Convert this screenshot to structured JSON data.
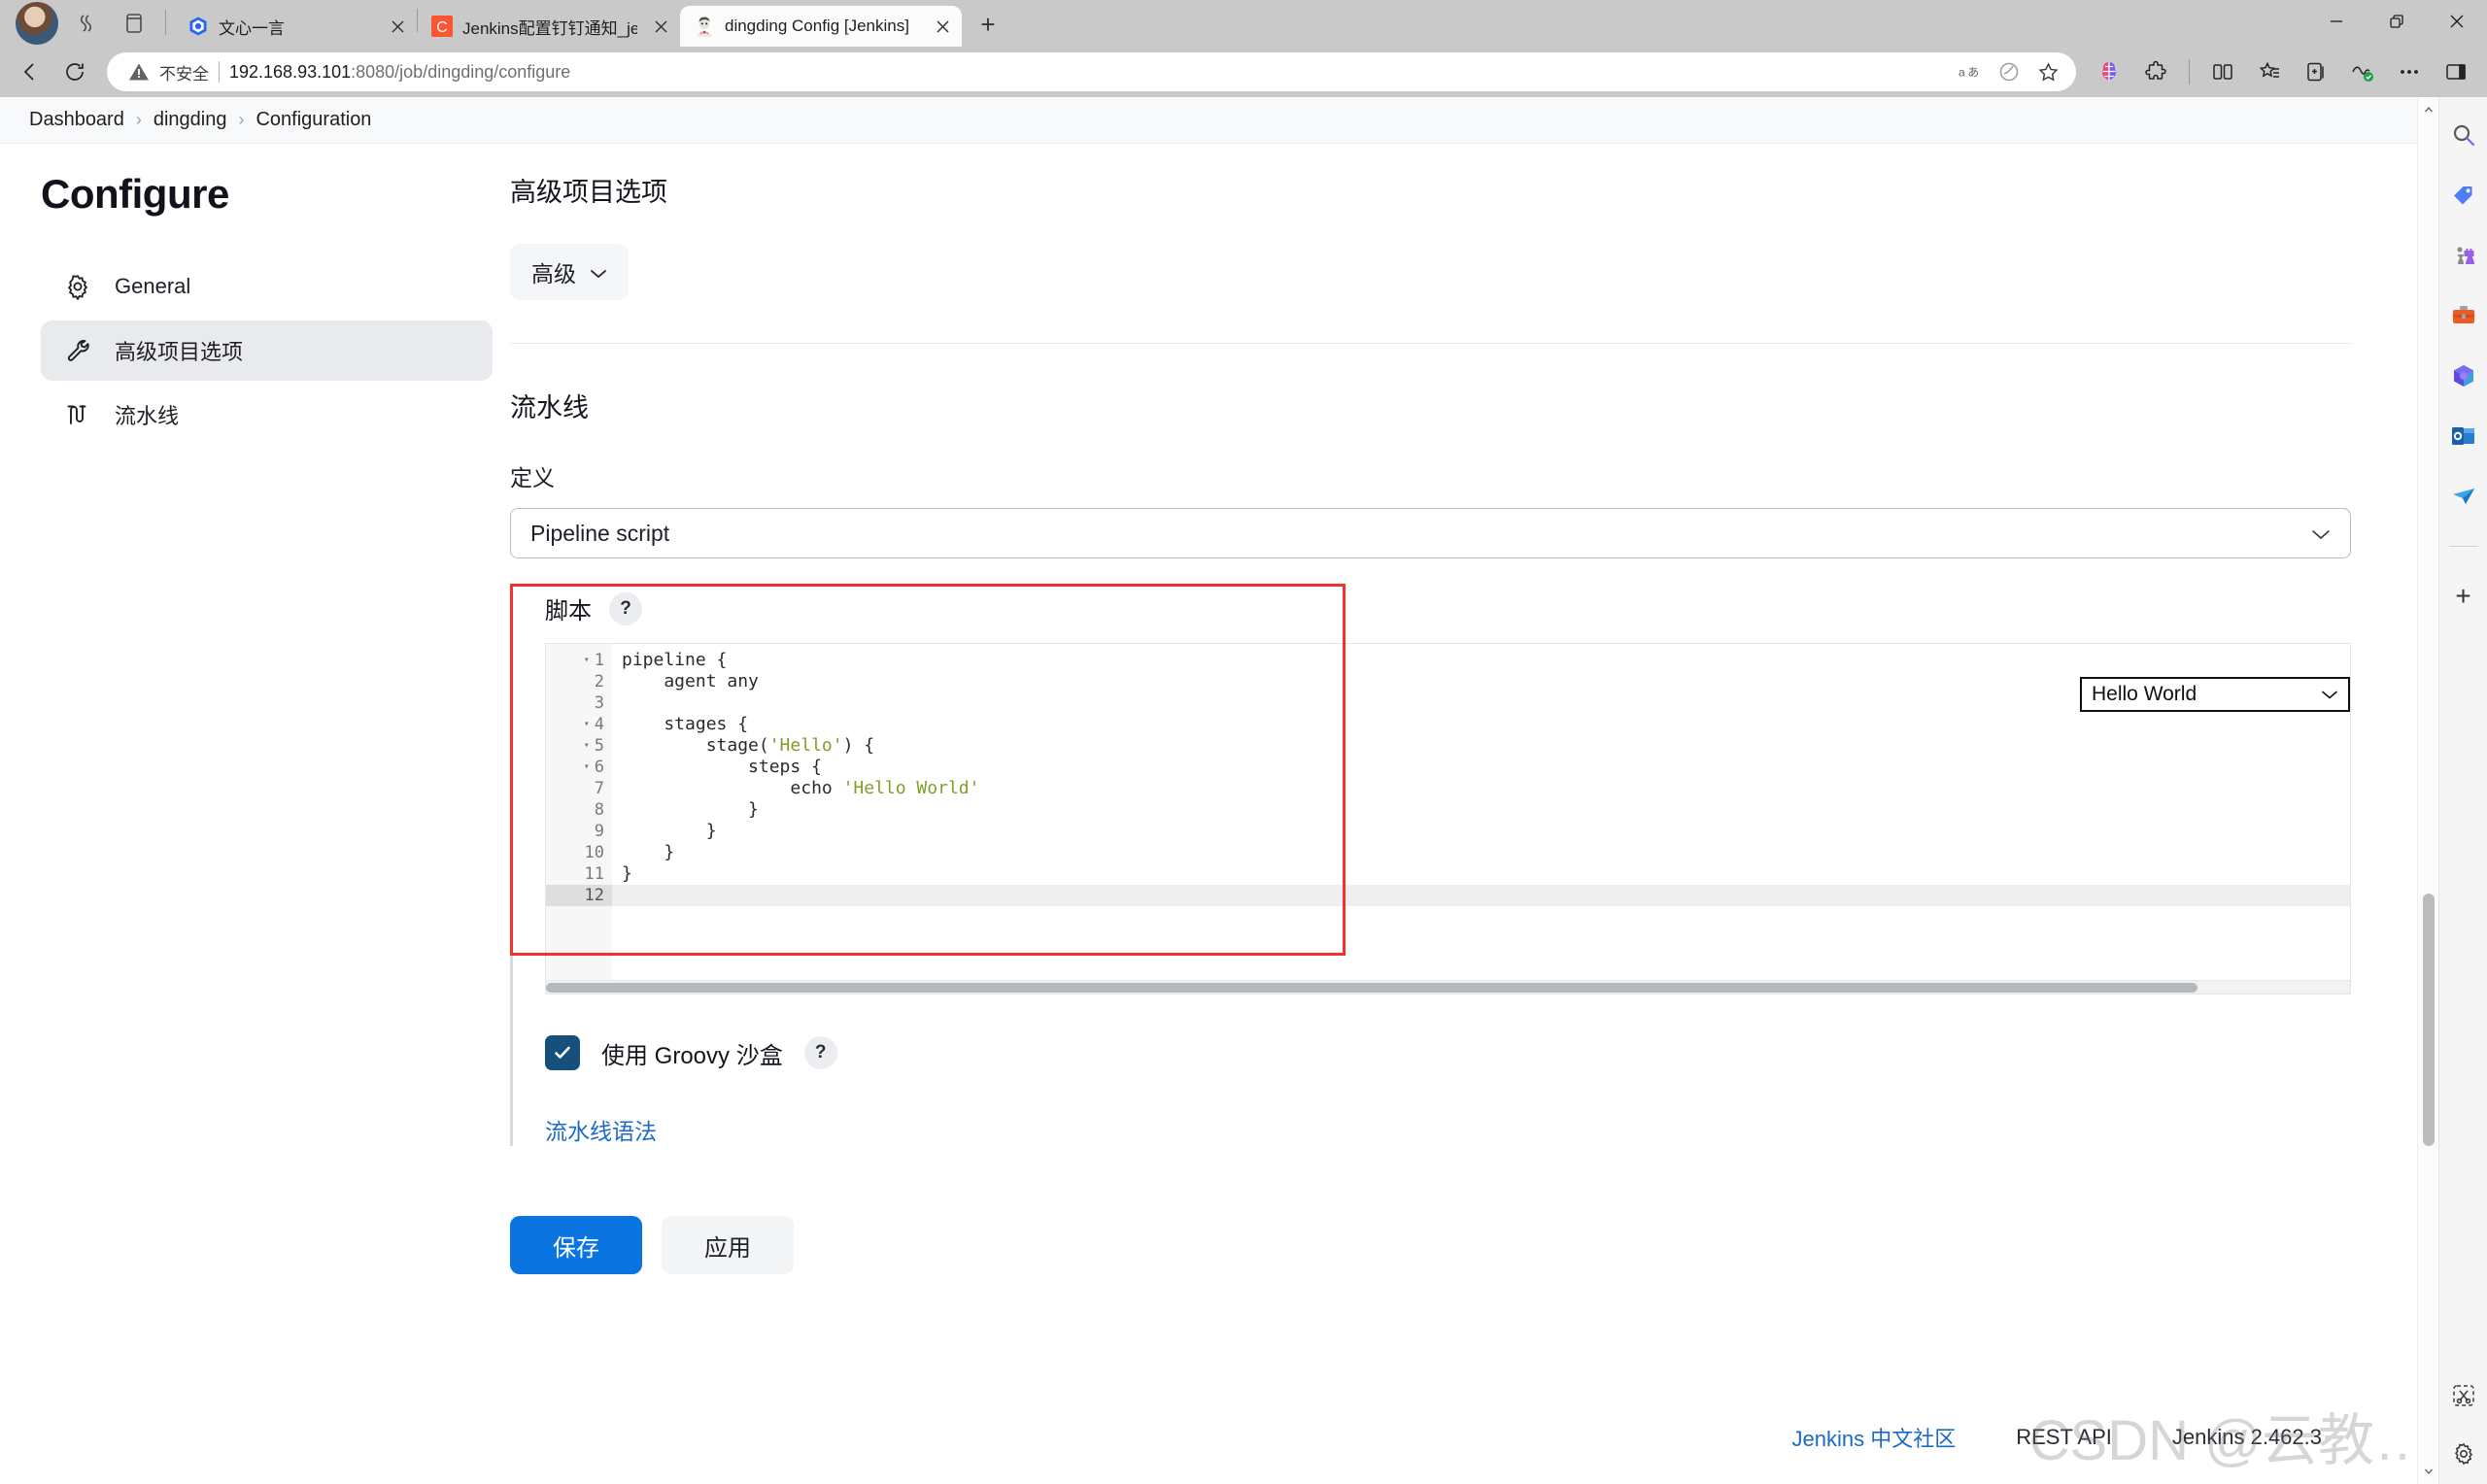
{
  "browser": {
    "window_controls": {
      "minimize": "minimize-icon",
      "maximize": "restore-icon",
      "close": "close-icon"
    },
    "tabs": [
      {
        "title": "文心一言",
        "favicon": "ernie-icon",
        "active": false
      },
      {
        "title": "Jenkins配置钉钉通知_jenkins钉钉",
        "favicon": "csdn-icon",
        "active": false
      },
      {
        "title": "dingding Config [Jenkins]",
        "favicon": "jenkins-butler-icon",
        "active": true
      }
    ],
    "new_tab_label": "+",
    "address": {
      "security_label": "不安全",
      "url_host": "192.168.93.101",
      "url_path": ":8080/job/dingding/configure",
      "full_url": "192.168.93.101:8080/job/dingding/configure"
    },
    "toolbar_icons": [
      "translate-icon",
      "read-aloud-icon",
      "favorite-star-icon",
      "copilot-icon",
      "extensions-icon",
      "split-screen-icon",
      "favorites-list-icon",
      "collections-icon",
      "browser-essentials-icon",
      "more-options-icon",
      "sidebar-toggle-icon"
    ],
    "sidebar_icons": [
      "search-icon",
      "shopping-tag-icon",
      "games-icon",
      "tools-icon",
      "microsoft365-icon",
      "outlook-icon",
      "send-icon"
    ],
    "sidebar_add_label": "+",
    "sidebar_bottom_icons": [
      "snip-tool-icon",
      "settings-gear-icon"
    ]
  },
  "breadcrumb": {
    "items": [
      "Dashboard",
      "dingding",
      "Configuration"
    ],
    "separator": "›"
  },
  "sidebar": {
    "title": "Configure",
    "items": [
      {
        "label": "General",
        "icon": "gear-icon",
        "active": false
      },
      {
        "label": "高级项目选项",
        "icon": "wrench-icon",
        "active": true
      },
      {
        "label": "流水线",
        "icon": "pipeline-icon",
        "active": false
      }
    ]
  },
  "main": {
    "advanced_section": {
      "heading": "高级项目选项",
      "button_label": "高级",
      "button_chevron": "chevron-down-icon"
    },
    "pipeline_section": {
      "heading": "流水线",
      "definition_label": "定义",
      "definition_value": "Pipeline script",
      "definition_chevron": "chevron-down-icon",
      "script_label": "脚本",
      "help_label": "?",
      "sample_select_value": "Hello World",
      "sample_select_chevron": "chevron-down-icon",
      "editor": {
        "lines": [
          {
            "n": "1",
            "fold": true,
            "text": "pipeline {"
          },
          {
            "n": "2",
            "fold": false,
            "text": "    agent any"
          },
          {
            "n": "3",
            "fold": false,
            "text": ""
          },
          {
            "n": "4",
            "fold": true,
            "text": "    stages {"
          },
          {
            "n": "5",
            "fold": true,
            "text": "        stage('Hello') {"
          },
          {
            "n": "6",
            "fold": true,
            "text": "            steps {"
          },
          {
            "n": "7",
            "fold": false,
            "text": "                echo 'Hello World'"
          },
          {
            "n": "8",
            "fold": false,
            "text": "            }"
          },
          {
            "n": "9",
            "fold": false,
            "text": "        }"
          },
          {
            "n": "10",
            "fold": false,
            "text": "    }"
          },
          {
            "n": "11",
            "fold": false,
            "text": "}"
          },
          {
            "n": "12",
            "fold": false,
            "text": ""
          }
        ],
        "current_line": "12",
        "fold_glyph": "▾"
      },
      "sandbox_label": "使用 Groovy 沙盒",
      "sandbox_help": "?",
      "sandbox_checked": true,
      "syntax_link": "流水线语法"
    },
    "buttons": {
      "save": "保存",
      "apply": "应用"
    }
  },
  "footer": {
    "community_link": "Jenkins 中文社区",
    "rest_api": "REST API",
    "version": "Jenkins 2.462.3"
  },
  "watermark": "CSDN @云教…",
  "colors": {
    "accent_blue": "#0a74e0",
    "link_blue": "#1b6ac9",
    "checkbox_navy": "#15507d",
    "annotation_red": "#f1332b",
    "sidebar_active_bg": "#e8eaee",
    "code_string_green": "#7f9f28"
  }
}
